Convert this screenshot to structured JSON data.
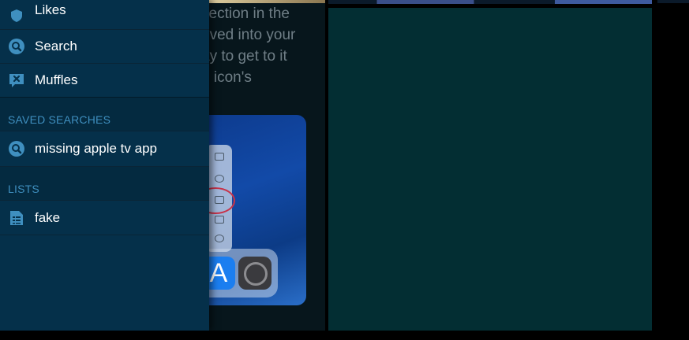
{
  "article": {
    "lines": [
      "section in the",
      "oved into your",
      "ay to get to it",
      "o icon's"
    ]
  },
  "sidebar": {
    "items": [
      {
        "label": "Likes",
        "icon": "heart-icon"
      },
      {
        "label": "Search",
        "icon": "search-icon"
      },
      {
        "label": "Muffles",
        "icon": "muffle-icon"
      }
    ],
    "saved_searches": {
      "header": "SAVED SEARCHES",
      "items": [
        {
          "label": "missing apple tv app",
          "icon": "search-icon"
        }
      ]
    },
    "lists": {
      "header": "LISTS",
      "items": [
        {
          "label": "fake",
          "icon": "list-icon"
        }
      ]
    }
  },
  "colors": {
    "drawer": "#05304a",
    "accent": "#3f8fbf",
    "right_panel": "#032e33"
  }
}
